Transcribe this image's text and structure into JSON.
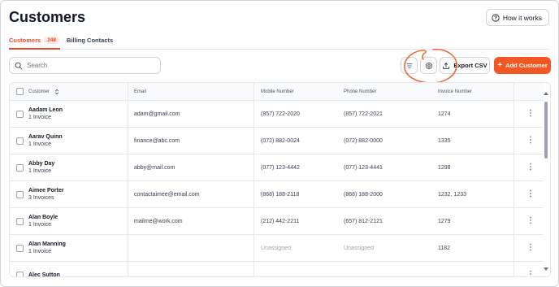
{
  "header": {
    "title": "Customers",
    "help_label": "How it works"
  },
  "tabs": [
    {
      "label": "Customers",
      "count": "248"
    },
    {
      "label": "Billing Contacts"
    }
  ],
  "search": {
    "placeholder": "Search",
    "value": ""
  },
  "toolbar": {
    "filter_icon": "filter-lines-icon",
    "settings_icon": "gear-icon",
    "export_label": "Export CSV",
    "add_label": "Add Customer",
    "accent": "#f25623"
  },
  "table": {
    "columns": [
      "Customer",
      "Email",
      "Mobile Number",
      "Phone Number",
      "Invoice Number"
    ],
    "rows": [
      {
        "name": "Aadam Leon",
        "invoices": "1 Invoice",
        "email": "adam@gmail.com",
        "mobile": "(857) 722-2020",
        "phone": "(857) 722-2021",
        "invoice": "1274"
      },
      {
        "name": "Aarav Quinn",
        "invoices": "1 Invoice",
        "email": "finance@abc.com",
        "mobile": "(072) 882-0024",
        "phone": "(072) 882-0000",
        "invoice": "1335"
      },
      {
        "name": "Abby Day",
        "invoices": "1 Invoice",
        "email": "abby@mail.com",
        "mobile": "(077) 123-4442",
        "phone": "(077) 123-4441",
        "invoice": "1298"
      },
      {
        "name": "Aimee Porter",
        "invoices": "3 Invoices",
        "email": "contactaimee@email.com",
        "mobile": "(868) 188-2118",
        "phone": "(868) 188-2000",
        "invoice": "1232, 1233"
      },
      {
        "name": "Alan Boyle",
        "invoices": "1 Invoice",
        "email": "mailme@work.com",
        "mobile": "(212) 442-2211",
        "phone": "(657) 812-2121",
        "invoice": "1279"
      },
      {
        "name": "Alan Manning",
        "invoices": "1 Invoice",
        "email": "",
        "mobile": "Unassigned",
        "phone": "Unassigned",
        "invoice": "1182"
      },
      {
        "name": "Alec Sutton",
        "invoices": "",
        "email": "",
        "mobile": "",
        "phone": "",
        "invoice": ""
      }
    ]
  }
}
